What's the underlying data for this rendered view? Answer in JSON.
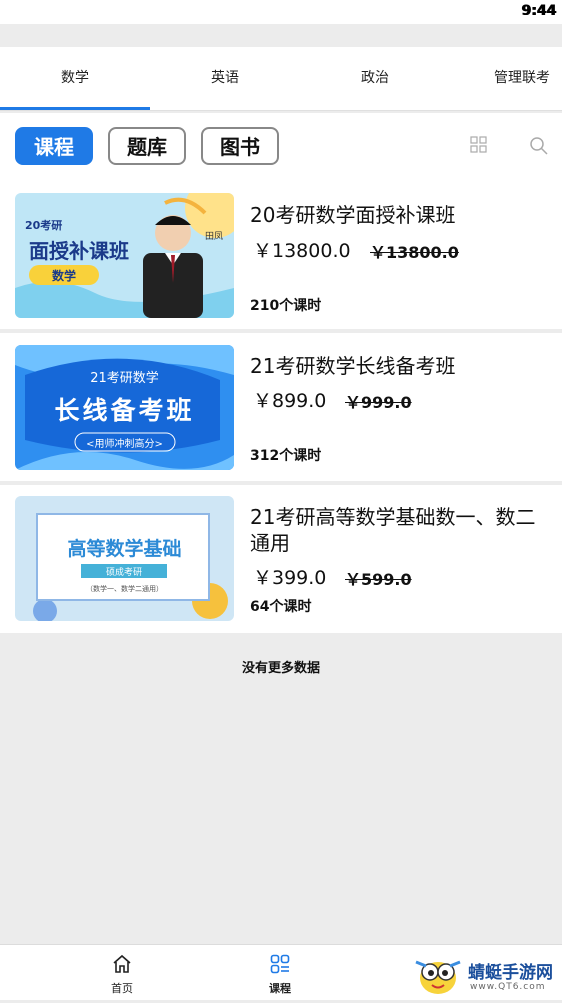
{
  "status_bar": {
    "time": "9:44"
  },
  "subject_tabs": [
    {
      "label": "数学",
      "active": true
    },
    {
      "label": "英语",
      "active": false
    },
    {
      "label": "政治",
      "active": false
    },
    {
      "label": "管理联考",
      "active": false
    }
  ],
  "type_buttons": [
    {
      "label": "课程",
      "active": true
    },
    {
      "label": "题库",
      "active": false
    },
    {
      "label": "图书",
      "active": false
    }
  ],
  "toolbar_icons": [
    "grid-view-icon",
    "search-icon"
  ],
  "courses": [
    {
      "title": "20考研数学面授补课班",
      "price": "￥13800.0",
      "original_price": "￥13800.0",
      "hours": "210个课时",
      "thumb": {
        "line1": "20考研",
        "line2": "面授补课班",
        "badge": "数学",
        "corner": "田凤"
      }
    },
    {
      "title": "21考研数学长线备考班",
      "price": "￥899.0",
      "original_price": "￥999.0",
      "hours": "312个课时",
      "thumb": {
        "line1": "21考研数学",
        "line2": "长线备考班",
        "line3": "<用师冲刺高分>"
      }
    },
    {
      "title": "21考研高等数学基础数一、数二通用",
      "price": "￥399.0",
      "original_price": "￥599.0",
      "hours": "64个课时",
      "thumb": {
        "line1": "高等数学基础",
        "line2": "硕成考研",
        "line3": "（数学一、数学二通用）"
      }
    }
  ],
  "no_more_text": "没有更多数据",
  "bottom_nav": [
    {
      "label": "首页",
      "icon": "home-icon",
      "active": false
    },
    {
      "label": "课程",
      "icon": "course-grid-icon",
      "active": true
    }
  ],
  "watermark": {
    "name": "蜻蜓手游网",
    "url": "www.QT6.com"
  },
  "colors": {
    "accent": "#1f7ae6",
    "background": "#ececec"
  }
}
